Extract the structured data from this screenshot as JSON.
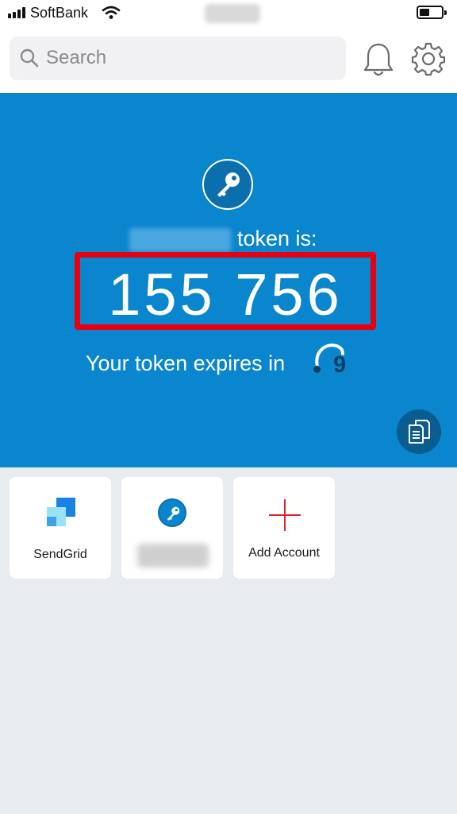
{
  "status_bar": {
    "carrier": "SoftBank",
    "icons": [
      "signal-icon",
      "wifi-icon",
      "battery-icon"
    ]
  },
  "header": {
    "search_placeholder": "Search",
    "icons": [
      "search-icon",
      "bell-icon",
      "gear-icon"
    ]
  },
  "token": {
    "label": "token is:",
    "code": "155 756",
    "expires_text": "Your token expires in",
    "seconds": "9",
    "icons": [
      "key-icon",
      "copy-icon"
    ]
  },
  "accounts": [
    {
      "label": "SendGrid",
      "icon": "sendgrid-logo"
    },
    {
      "label": "",
      "icon": "key-icon"
    },
    {
      "label": "Add Account",
      "icon": "plus-icon"
    }
  ],
  "colors": {
    "panel_blue": "#0a86ce",
    "highlight_red": "#e60012",
    "background": "#e8ecf0",
    "add_red": "#e2222a"
  }
}
